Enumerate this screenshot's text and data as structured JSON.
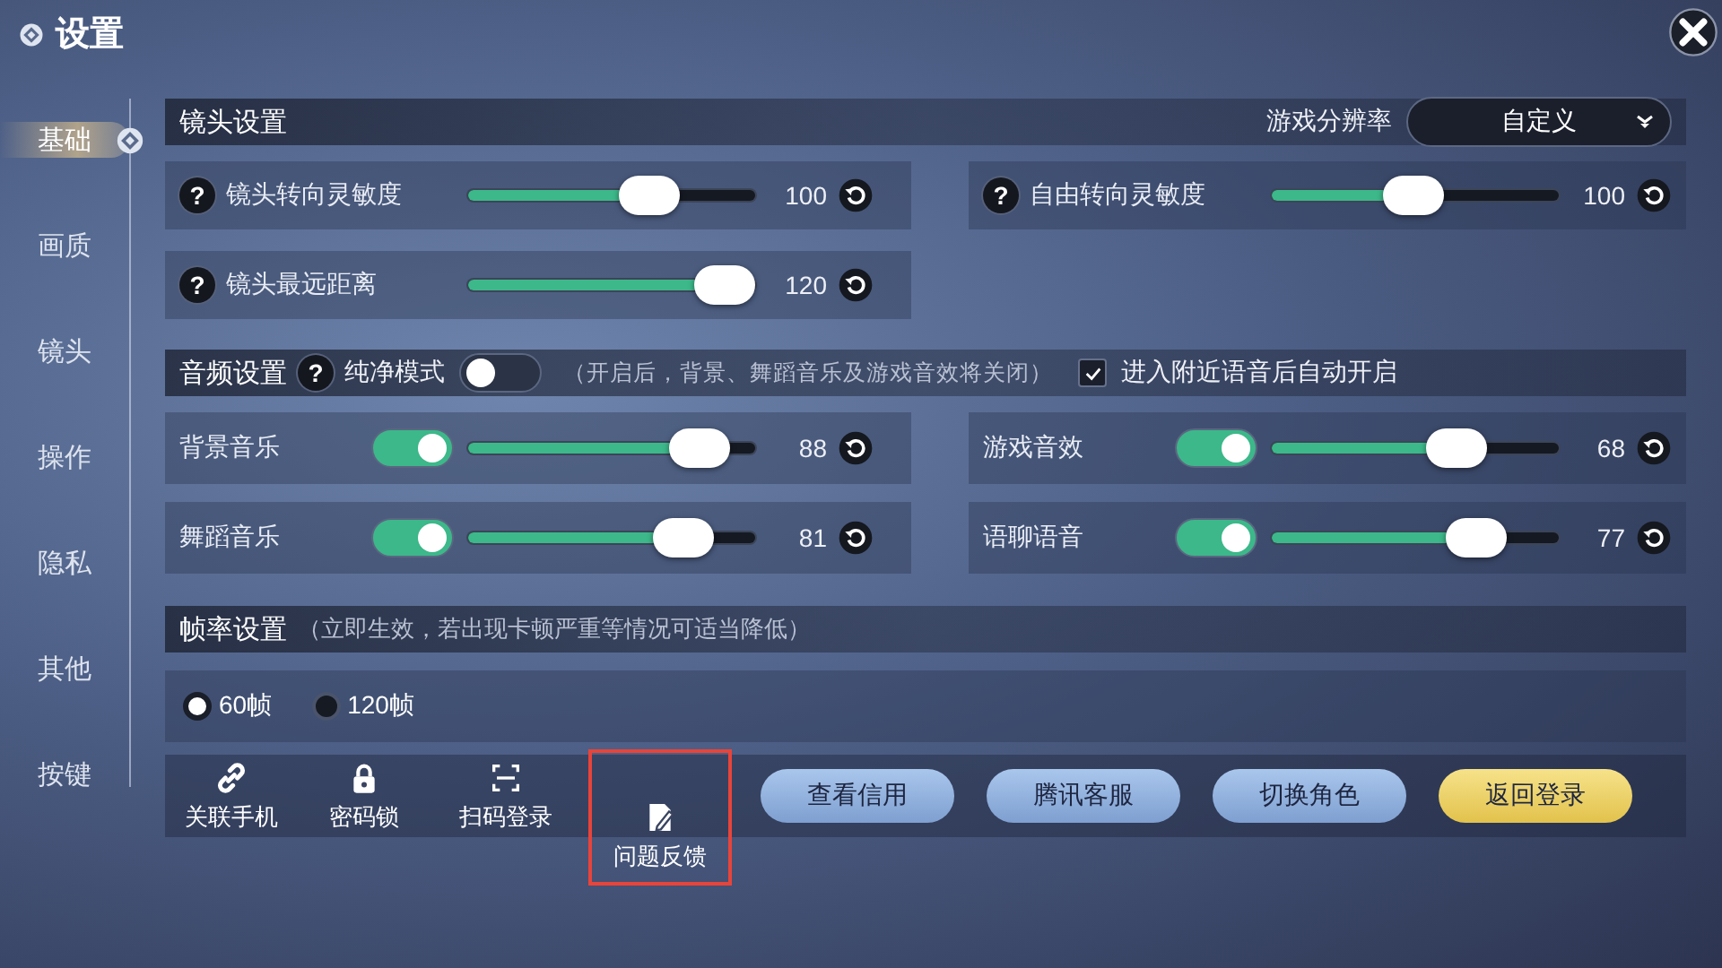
{
  "window": {
    "title": "设置"
  },
  "sidebar": {
    "items": [
      {
        "label": "基础",
        "selected": true
      },
      {
        "label": "画质",
        "selected": false
      },
      {
        "label": "镜头",
        "selected": false
      },
      {
        "label": "操作",
        "selected": false
      },
      {
        "label": "隐私",
        "selected": false
      },
      {
        "label": "其他",
        "selected": false
      },
      {
        "label": "按键",
        "selected": false
      }
    ]
  },
  "camera": {
    "title": "镜头设置",
    "resolution": {
      "label": "游戏分辨率",
      "value": "自定义"
    },
    "rows": [
      [
        {
          "help": "?",
          "label": "镜头转向灵敏度",
          "level": 0.67,
          "reading": "100"
        },
        {
          "help": "?",
          "label": "自由转向灵敏度",
          "level": 0.49,
          "reading": "100"
        }
      ],
      [
        {
          "help": "?",
          "label": "镜头最远距离",
          "level": 1.0,
          "reading": "120"
        }
      ]
    ]
  },
  "audio": {
    "title": "音频设置",
    "help": "?",
    "pure_mode": {
      "label": "纯净模式",
      "on": false
    },
    "note": "（开启后，背景、舞蹈音乐及游戏音效将关闭）",
    "auto_voice": {
      "label": "进入附近语音后自动开启",
      "checked": true
    },
    "rows": [
      [
        {
          "label": "背景音乐",
          "on": true,
          "level": 0.89,
          "reading": "88"
        },
        {
          "label": "游戏音效",
          "on": true,
          "level": 0.68,
          "reading": "68"
        }
      ],
      [
        {
          "label": "舞蹈音乐",
          "on": true,
          "level": 0.82,
          "reading": "81"
        },
        {
          "label": "语聊语音",
          "on": true,
          "level": 0.77,
          "reading": "77"
        }
      ]
    ]
  },
  "framerate": {
    "title": "帧率设置",
    "note": "（立即生效，若出现卡顿严重等情况可适当降低）",
    "options": [
      {
        "label": "60帧",
        "selected": true
      },
      {
        "label": "120帧",
        "selected": false
      }
    ]
  },
  "actions": {
    "shortcuts": [
      {
        "label": "关联手机",
        "highlighted": false
      },
      {
        "label": "密码锁",
        "highlighted": false
      },
      {
        "label": "扫码登录",
        "highlighted": false
      },
      {
        "label": "问题反馈",
        "highlighted": true
      }
    ],
    "buttons": [
      {
        "label": "查看信用",
        "kind": "normal"
      },
      {
        "label": "腾讯客服",
        "kind": "normal"
      },
      {
        "label": "切换角色",
        "kind": "normal"
      },
      {
        "label": "返回登录",
        "kind": "gold"
      }
    ]
  }
}
